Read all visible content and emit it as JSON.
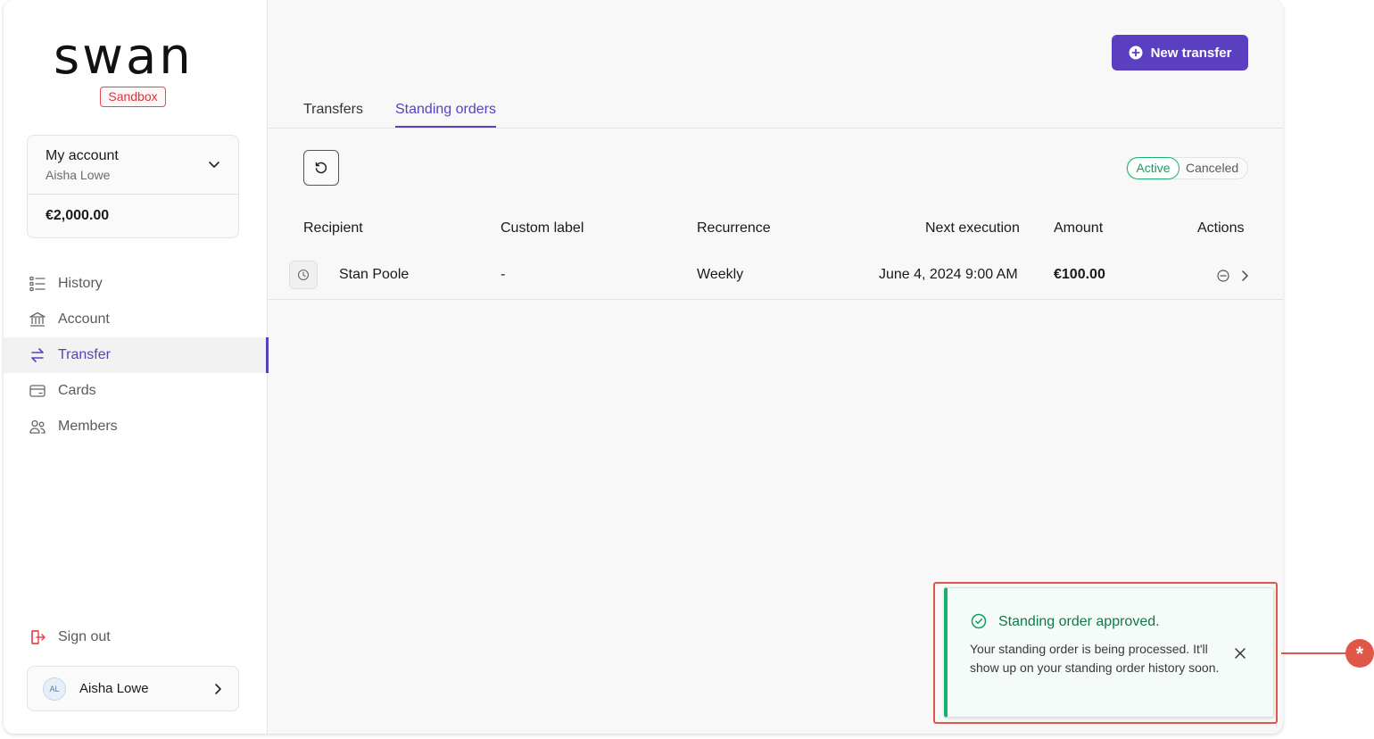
{
  "brand": {
    "logo_text": "swan",
    "env_badge": "Sandbox"
  },
  "account": {
    "title": "My account",
    "holder": "Aisha Lowe",
    "balance": "€2,000.00"
  },
  "nav": {
    "items": [
      {
        "label": "History",
        "icon": "list-icon"
      },
      {
        "label": "Account",
        "icon": "bank-icon"
      },
      {
        "label": "Transfer",
        "icon": "arrows-swap-icon",
        "active": true
      },
      {
        "label": "Cards",
        "icon": "card-icon"
      },
      {
        "label": "Members",
        "icon": "people-icon"
      }
    ],
    "signout_label": "Sign out"
  },
  "user": {
    "initials": "AL",
    "name": "Aisha Lowe"
  },
  "header": {
    "new_transfer_label": "New transfer"
  },
  "tabs": [
    {
      "label": "Transfers",
      "active": false
    },
    {
      "label": "Standing orders",
      "active": true
    }
  ],
  "filter": {
    "active_label": "Active",
    "canceled_label": "Canceled"
  },
  "table": {
    "columns": [
      "Recipient",
      "Custom label",
      "Recurrence",
      "Next execution",
      "Amount",
      "Actions"
    ],
    "rows": [
      {
        "recipient": "Stan Poole",
        "custom_label": "-",
        "recurrence": "Weekly",
        "next_execution": "June 4, 2024 9:00 AM",
        "amount": "€100.00"
      }
    ]
  },
  "toast": {
    "title": "Standing order approved.",
    "body": "Your standing order is being processed. It'll show up on your standing order history soon."
  },
  "annotation": {
    "marker": "*"
  },
  "colors": {
    "accent": "#5a3fc0",
    "success": "#17b26a",
    "danger": "#e5484d",
    "annotation": "#e0574a"
  }
}
